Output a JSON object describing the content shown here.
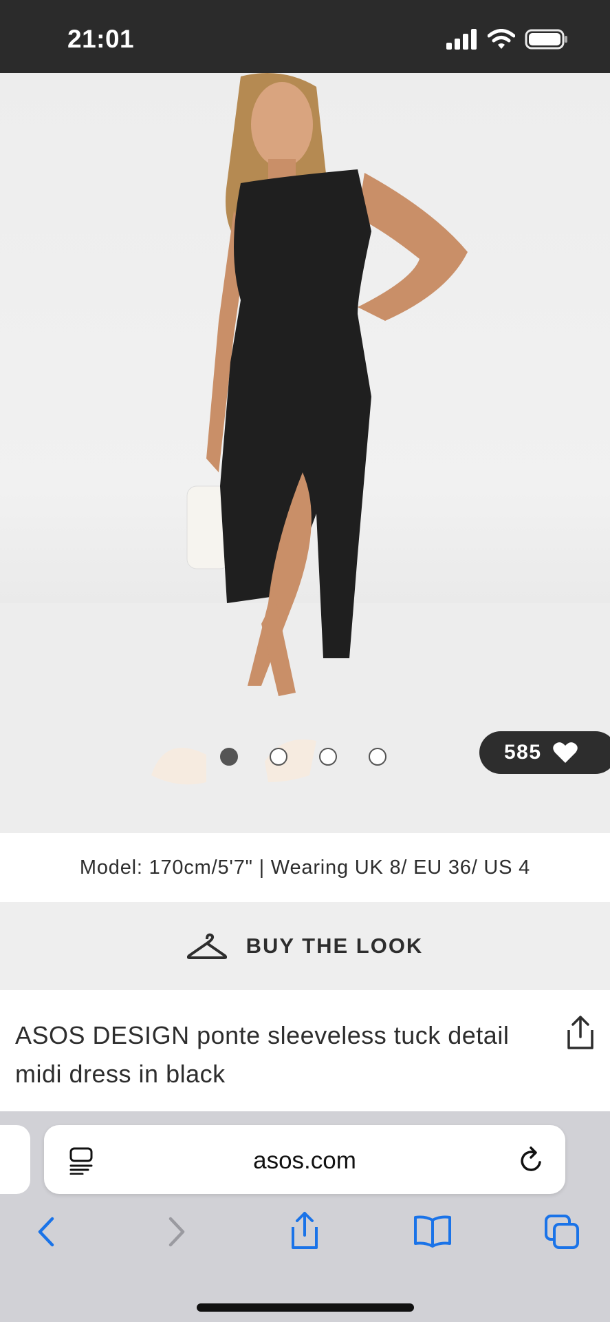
{
  "status_bar": {
    "time": "21:01",
    "icons": [
      "signal-icon",
      "wifi-icon",
      "battery-icon"
    ]
  },
  "gallery": {
    "image_count": 4,
    "active_index": 0,
    "likes": "585",
    "likes_icon": "heart-icon"
  },
  "model_info": "Model: 170cm/5'7\" | Wearing UK 8/ EU 36/ US 4",
  "buy_the_look": {
    "label": "BUY THE LOOK",
    "icon": "hanger-icon"
  },
  "product": {
    "title": "ASOS DESIGN ponte sleeveless tuck detail midi dress in black",
    "share_icon": "share-icon"
  },
  "browser": {
    "url": "asos.com",
    "left_icon": "reader-icon",
    "right_icon": "reload-icon",
    "toolbar": [
      "back-icon",
      "forward-icon",
      "share-icon",
      "bookmarks-icon",
      "tabs-icon"
    ]
  },
  "colors": {
    "status_bar_bg": "#2b2b2b",
    "text_dark": "#2d2d2d",
    "browser_bg": "#d1d1d6",
    "ios_blue": "#1a73e8"
  }
}
